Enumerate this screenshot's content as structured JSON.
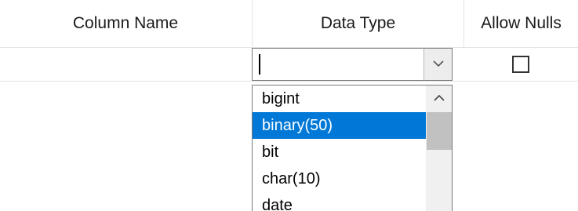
{
  "grid": {
    "columns": {
      "name": "Column Name",
      "type": "Data Type",
      "nulls": "Allow Nulls"
    },
    "row": {
      "name_value": "",
      "type_value": "",
      "allow_nulls_checked": false
    }
  },
  "dropdown": {
    "options": [
      "bigint",
      "binary(50)",
      "bit",
      "char(10)",
      "date"
    ],
    "selected": "binary(50)"
  },
  "icons": {
    "dropdown_arrow": "chevron-down-icon",
    "scroll_up": "chevron-up-icon"
  },
  "colors": {
    "selection": "#0078d7",
    "border": "#7a7a7a"
  }
}
